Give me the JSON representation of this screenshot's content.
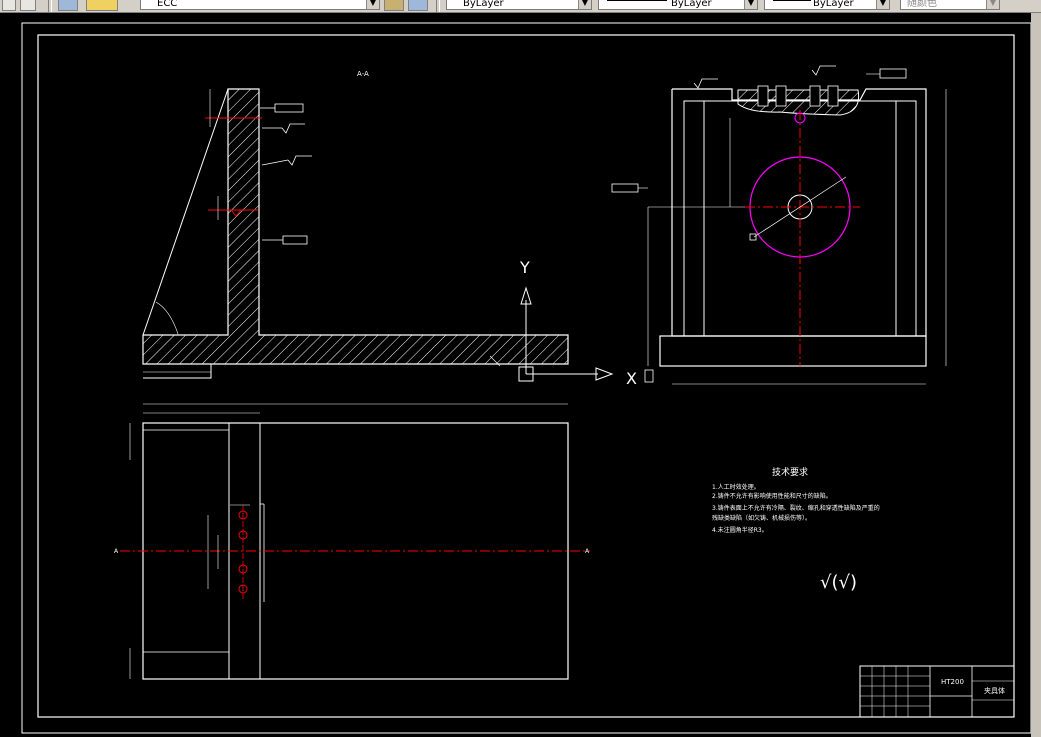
{
  "toolbar": {
    "layer_combo": "ECC",
    "color_combo": "ByLayer",
    "linetype_combo": "ByLayer",
    "lineweight_combo": "ByLayer",
    "plotstyle_combo": "随颜色"
  },
  "drawing": {
    "section_label": "A-A",
    "axis_y": "Y",
    "axis_x": "X",
    "material": "HT200",
    "part_name": "夹具体",
    "tech_title": "技术要求",
    "tech_notes": [
      "1.人工时效处理。",
      "2.铸件不允许有影响使用性能和尺寸的缺陷。",
      "3.铸件表面上不允许有冷隔、裂纹、缩孔和穿透性缺陷及严重的",
      "残缺类缺陷（如欠铸、机械损伤等）。",
      "4.未注圆角半径R3。"
    ],
    "roughness_note": "√(√)",
    "section_marks": [
      "A",
      "A"
    ]
  },
  "colors": {
    "background": "#000000",
    "lines": "#ffffff",
    "centerline": "#ff0000",
    "circle": "#ff00ff"
  }
}
